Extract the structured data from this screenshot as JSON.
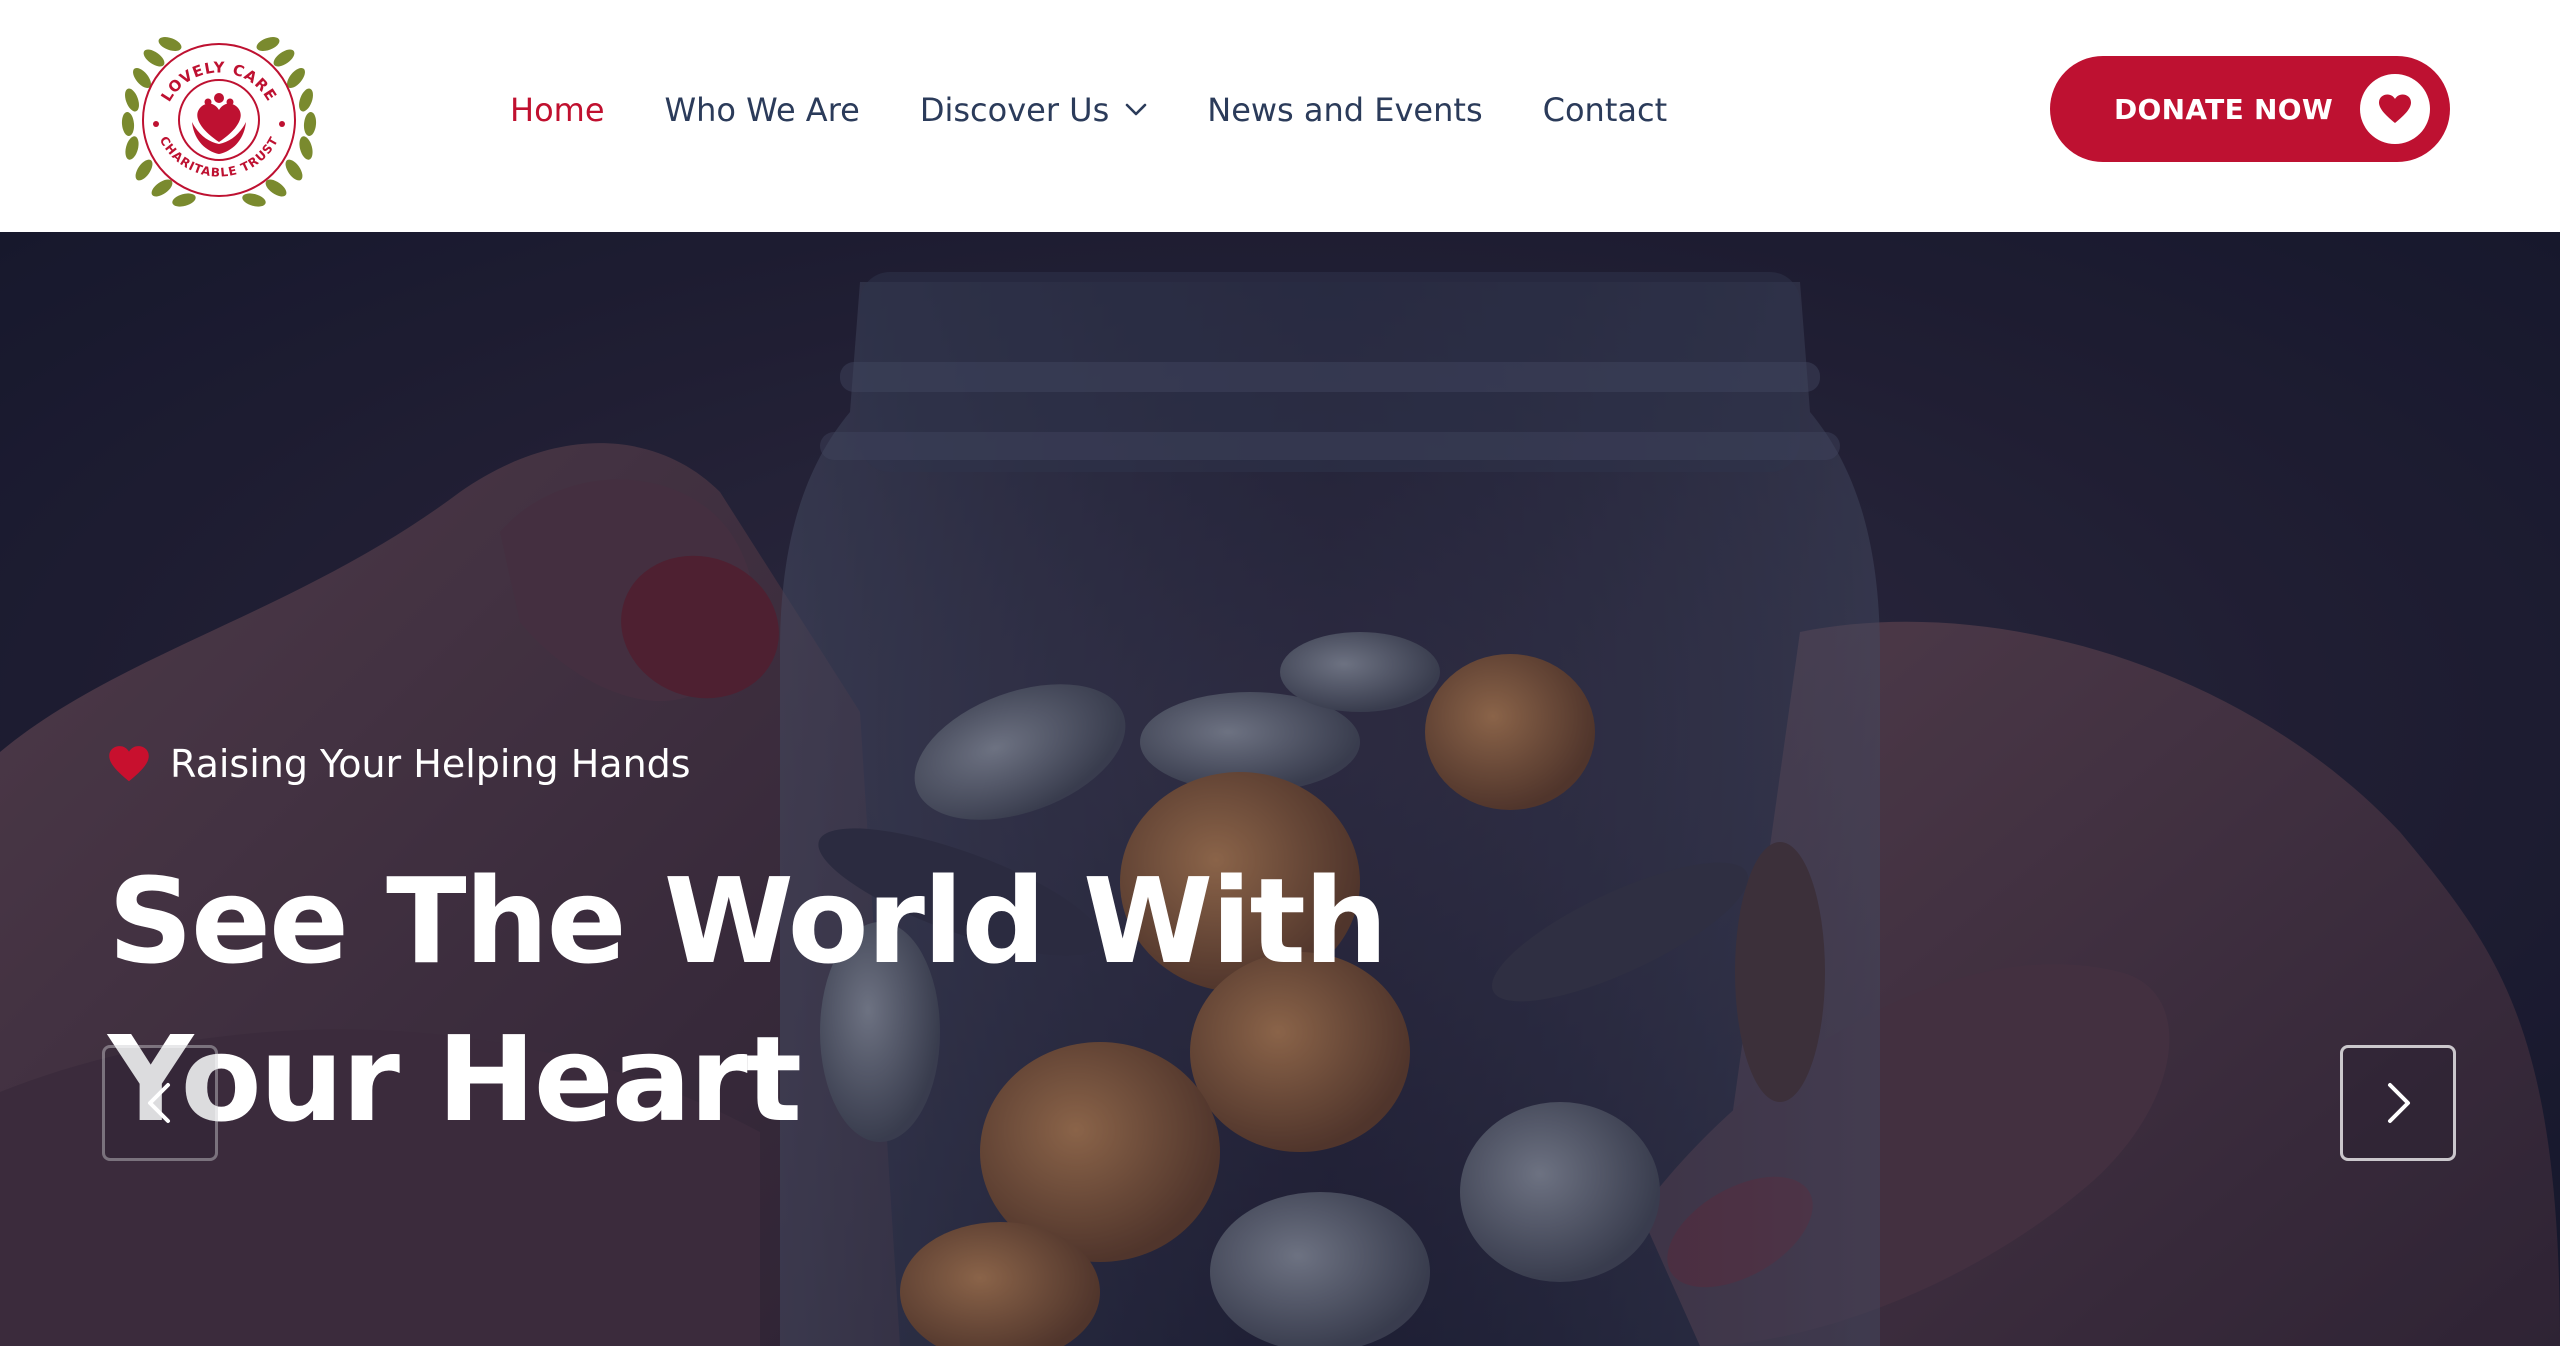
{
  "brand": {
    "logo_top_text": "LOVELY CARE",
    "logo_bottom_text": "CHARITABLE TRUST",
    "logo_icon": "hands-heart-logo-icon"
  },
  "nav": {
    "items": [
      {
        "label": "Home",
        "active": true
      },
      {
        "label": "Who We Are",
        "active": false
      },
      {
        "label": "Discover Us",
        "active": false,
        "dropdown_icon": "chevron-down-icon"
      },
      {
        "label": "News and Events",
        "active": false
      },
      {
        "label": "Contact",
        "active": false
      }
    ]
  },
  "donate": {
    "label": "DONATE NOW",
    "icon": "heart-icon"
  },
  "hero": {
    "tagline": "Raising Your Helping Hands",
    "tagline_icon": "heart-icon",
    "title_line1": "See The World With",
    "title_line2": "Your Heart",
    "prev_icon": "chevron-left-icon",
    "next_icon": "chevron-right-icon",
    "image": "hands holding glass jar of coins"
  },
  "colors": {
    "brand_red": "#be1131",
    "nav_text": "#2b3b5a",
    "nav_active": "#c0102f",
    "hero_overlay": "#1a1c33",
    "logo_wreath": "#7a8a2e"
  }
}
